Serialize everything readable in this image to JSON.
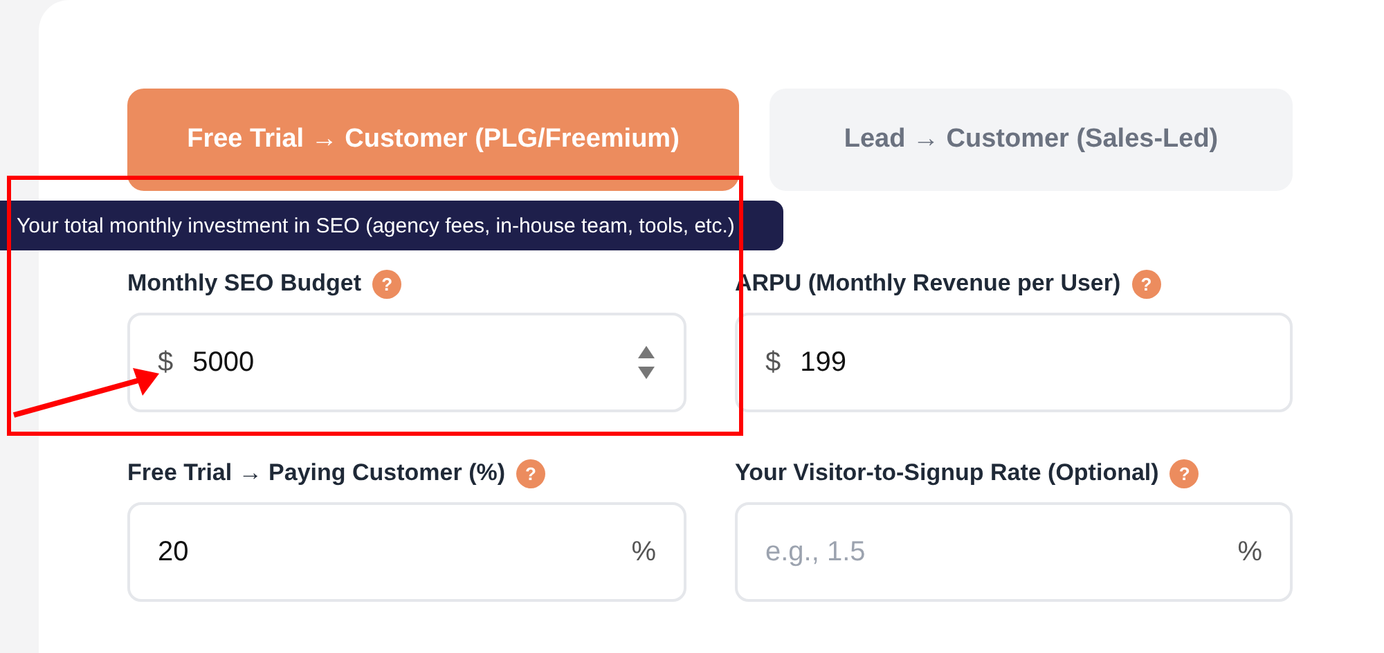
{
  "tabs": [
    {
      "label": "Free Trial → Customer (PLG/Freemium)",
      "selected": true
    },
    {
      "label": "Lead → Customer (Sales-Led)",
      "selected": false
    }
  ],
  "tooltip": {
    "text": "Your total monthly investment in SEO (agency fees, in-house team, tools, etc.)"
  },
  "fields": [
    {
      "label": "Monthly SEO Budget",
      "help": "?",
      "prefix": "$",
      "value": "5000",
      "spinner": true
    },
    {
      "label": "ARPU (Monthly Revenue per User)",
      "help": "?",
      "prefix": "$",
      "value": "199"
    },
    {
      "label": "Free Trial → Paying Customer (%)",
      "help": "?",
      "value": "20",
      "suffix": "%"
    },
    {
      "label": "Your Visitor-to-Signup Rate (Optional)",
      "help": "?",
      "placeholder": "e.g., 1.5",
      "suffix": "%"
    }
  ],
  "annotation_box": true,
  "annotation_arrow": true
}
